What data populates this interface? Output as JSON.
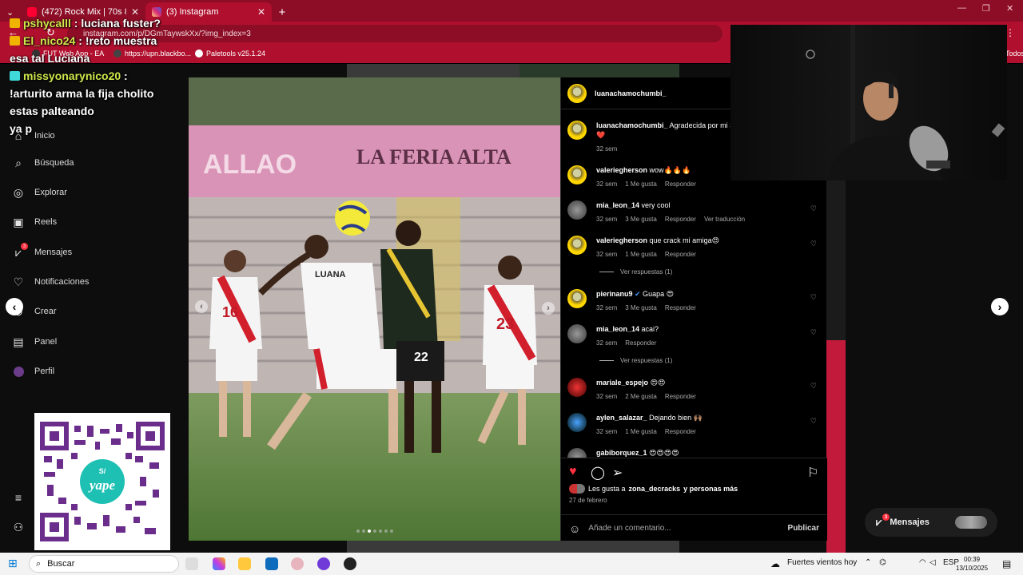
{
  "browser": {
    "tabs": [
      {
        "title": "(472) Rock Mix | 70s 80s |",
        "active": false
      },
      {
        "title": "(3) Instagram",
        "active": true
      }
    ],
    "new_tab": "+",
    "url": "instagram.com/p/DGmTaywskXx/?img_index=3",
    "bookmarks": [
      "FUT Web App - EA",
      "https://upn.blackbo...",
      "Paletools v25.1.24"
    ],
    "bookmarks_right": "Todos"
  },
  "chat": [
    {
      "user": "pshycalll",
      "message": "luciana fuster?"
    },
    {
      "user": "El_nico24",
      "message": "!reto muestra esa tal Luciana"
    },
    {
      "user": "missyonarynico20",
      "message": "!arturito arma la fija cholito estas palteando"
    },
    {
      "user": "",
      "message": "ya p"
    }
  ],
  "nav": {
    "items": [
      {
        "label": "Inicio",
        "icon": "home-icon"
      },
      {
        "label": "Búsqueda",
        "icon": "search-icon"
      },
      {
        "label": "Explorar",
        "icon": "compass-icon"
      },
      {
        "label": "Reels",
        "icon": "reels-icon"
      },
      {
        "label": "Mensajes",
        "icon": "messenger-icon",
        "badge": "3"
      },
      {
        "label": "Notificaciones",
        "icon": "heart-icon"
      },
      {
        "label": "Crear",
        "icon": "plus-icon"
      },
      {
        "label": "Panel",
        "icon": "chart-icon"
      },
      {
        "label": "Perfil",
        "icon": "avatar-icon"
      }
    ]
  },
  "qr": {
    "brand": "yape",
    "currency": "S/"
  },
  "post": {
    "author": "luanachamochumbi_",
    "caption": {
      "user": "luanachamochumbi_",
      "text": "Agradecida por mi Selección Absoluta 🇵🇪❤️",
      "time": "32 sem"
    },
    "comments": [
      {
        "user": "valeriegherson",
        "text": "wow🔥🔥🔥",
        "time": "32 sem",
        "likes": "1 Me gusta",
        "reply": "Responder"
      },
      {
        "user": "mia_leon_14",
        "text": "very cool",
        "time": "32 sem",
        "likes": "3 Me gusta",
        "reply": "Responder",
        "extra": "Ver traducción"
      },
      {
        "user": "valeriegherson",
        "text": "que crack mi amiga😍",
        "time": "32 sem",
        "likes": "1 Me gusta",
        "reply": "Responder",
        "replies": "Ver respuestas (1)"
      },
      {
        "user": "pierinanu9",
        "text": "Guapa 😍",
        "time": "32 sem",
        "likes": "3 Me gusta",
        "reply": "Responder"
      },
      {
        "user": "mia_leon_14",
        "text": "acai?",
        "time": "32 sem",
        "likes": "",
        "reply": "Responder",
        "replies": "Ver respuestas (1)"
      },
      {
        "user": "mariale_espejo",
        "text": "😍😍",
        "time": "32 sem",
        "likes": "2 Me gusta",
        "reply": "Responder"
      },
      {
        "user": "aylen_salazar_",
        "text": "Dejando bien 🙌🏽",
        "time": "32 sem",
        "likes": "1 Me gusta",
        "reply": "Responder"
      },
      {
        "user": "gabiborquez_1",
        "text": "😍😍😍😍",
        "time": "",
        "likes": "",
        "reply": ""
      }
    ],
    "likes_text": "Les gusta a",
    "likes_user": "zona_decracks",
    "likes_tail": "y personas más",
    "date": "27 de febrero",
    "comment_placeholder": "Añade un comentario...",
    "publish": "Publicar",
    "jersey_name": "LUANA",
    "jersey_numbers": [
      "16",
      "23",
      "22"
    ],
    "banner": "LA FERIA ALTA",
    "stadium_text": "ALLAO"
  },
  "messages_pill": "Mensajes",
  "taskbar": {
    "search": "Buscar",
    "weather": "Fuertes vientos hoy",
    "lang": "ESP",
    "time": "00:39",
    "date": "13/10/2025"
  },
  "colors": {
    "browser": "#b0102e",
    "ig_bg": "#000000",
    "like_red": "#ff3040"
  }
}
